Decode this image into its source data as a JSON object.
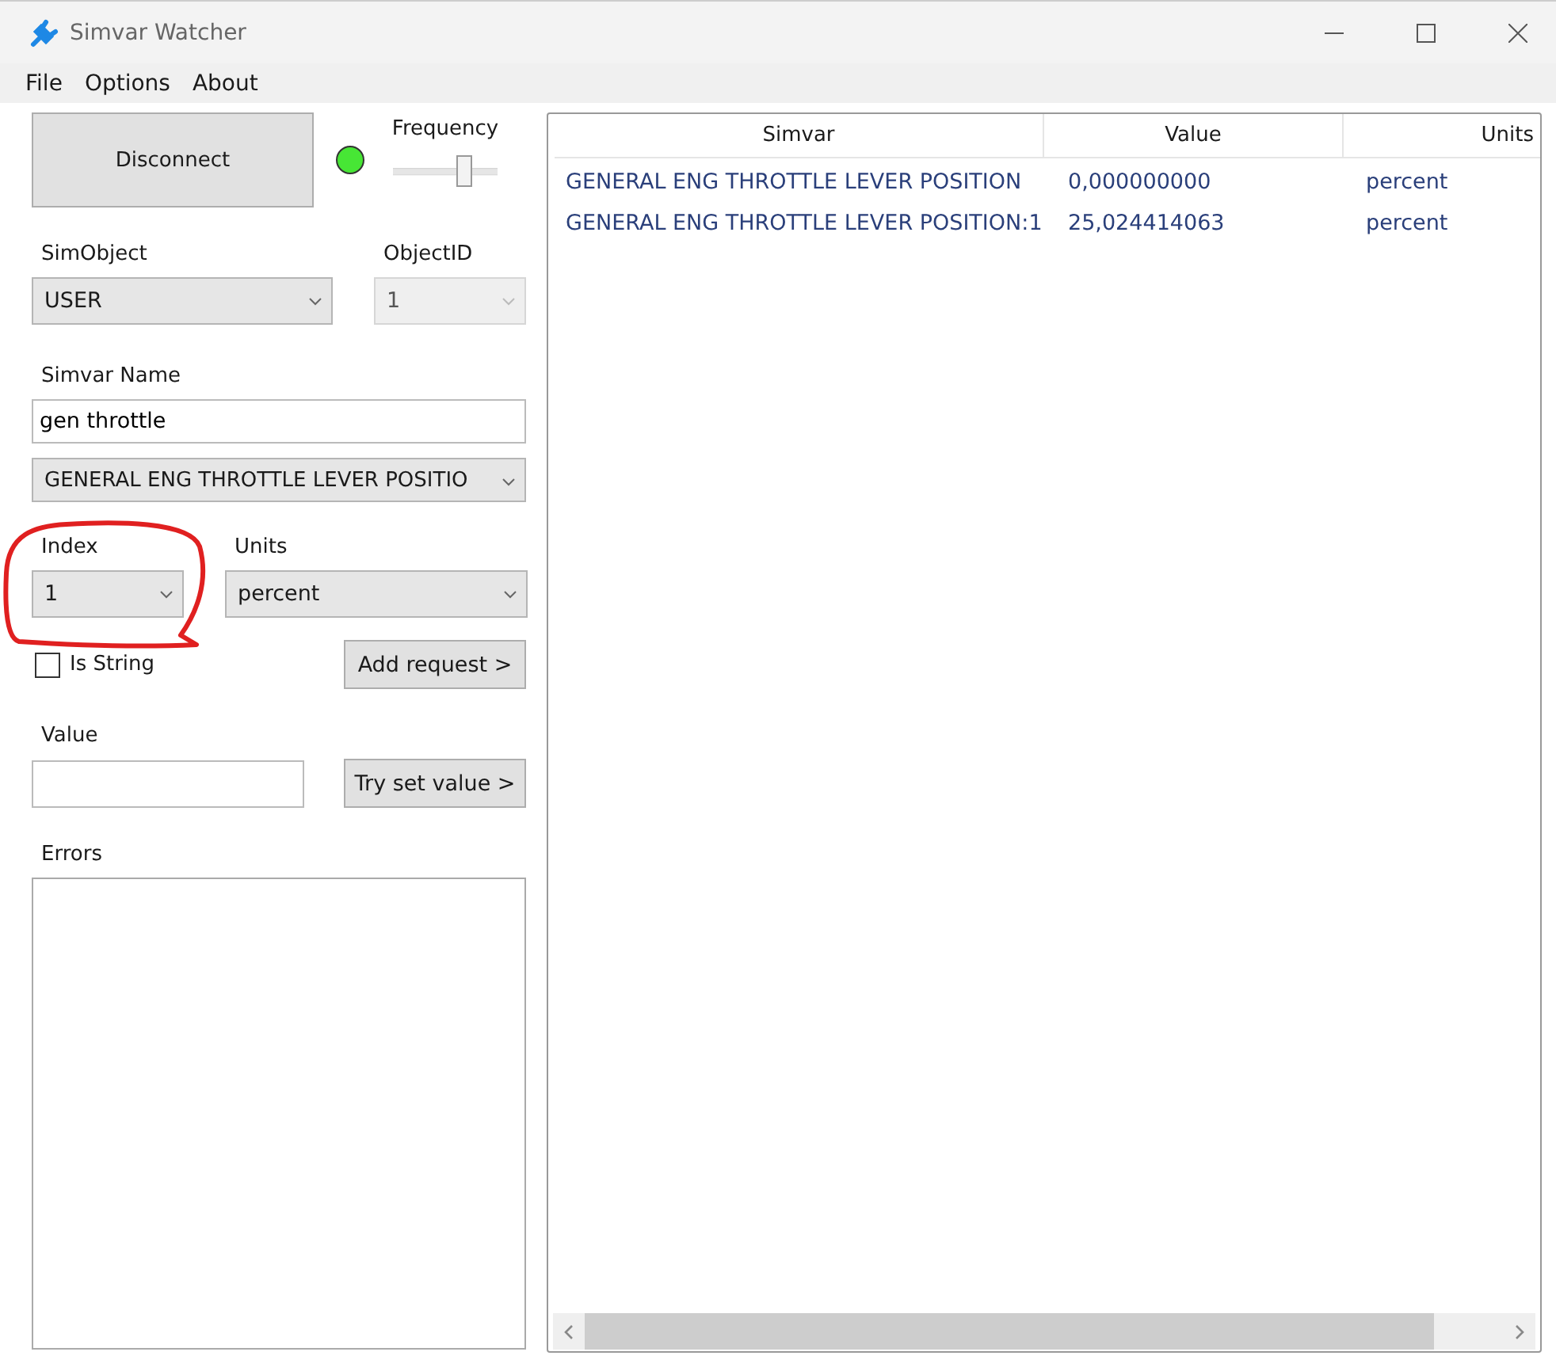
{
  "window": {
    "title": "Simvar Watcher"
  },
  "menu": [
    "File",
    "Options",
    "About"
  ],
  "connection": {
    "button": "Disconnect",
    "connected": true
  },
  "frequency": {
    "label": "Frequency",
    "level": 0.68
  },
  "sim_object": {
    "label": "SimObject",
    "value": "USER"
  },
  "object_id": {
    "label": "ObjectID",
    "value": "1",
    "disabled": true
  },
  "simvar_name": {
    "label": "Simvar Name",
    "value": "gen throttle",
    "match": "GENERAL ENG THROTTLE LEVER POSITIO"
  },
  "index": {
    "label": "Index",
    "value": "1"
  },
  "units": {
    "label": "Units",
    "value": "percent"
  },
  "is_string": {
    "label": "Is String",
    "checked": false
  },
  "add_request": "Add request >",
  "value": {
    "label": "Value"
  },
  "try_set_value": "Try set value >",
  "errors": {
    "label": "Errors"
  },
  "table": {
    "columns": [
      "Simvar",
      "Value",
      "Units"
    ],
    "rows": [
      {
        "simvar": "GENERAL ENG THROTTLE LEVER POSITION",
        "value": "0,000000000",
        "units": "percent"
      },
      {
        "simvar": "GENERAL ENG THROTTLE LEVER POSITION:1",
        "value": "25,024414063",
        "units": "percent"
      }
    ]
  },
  "annotation": {
    "kind": "circle"
  }
}
